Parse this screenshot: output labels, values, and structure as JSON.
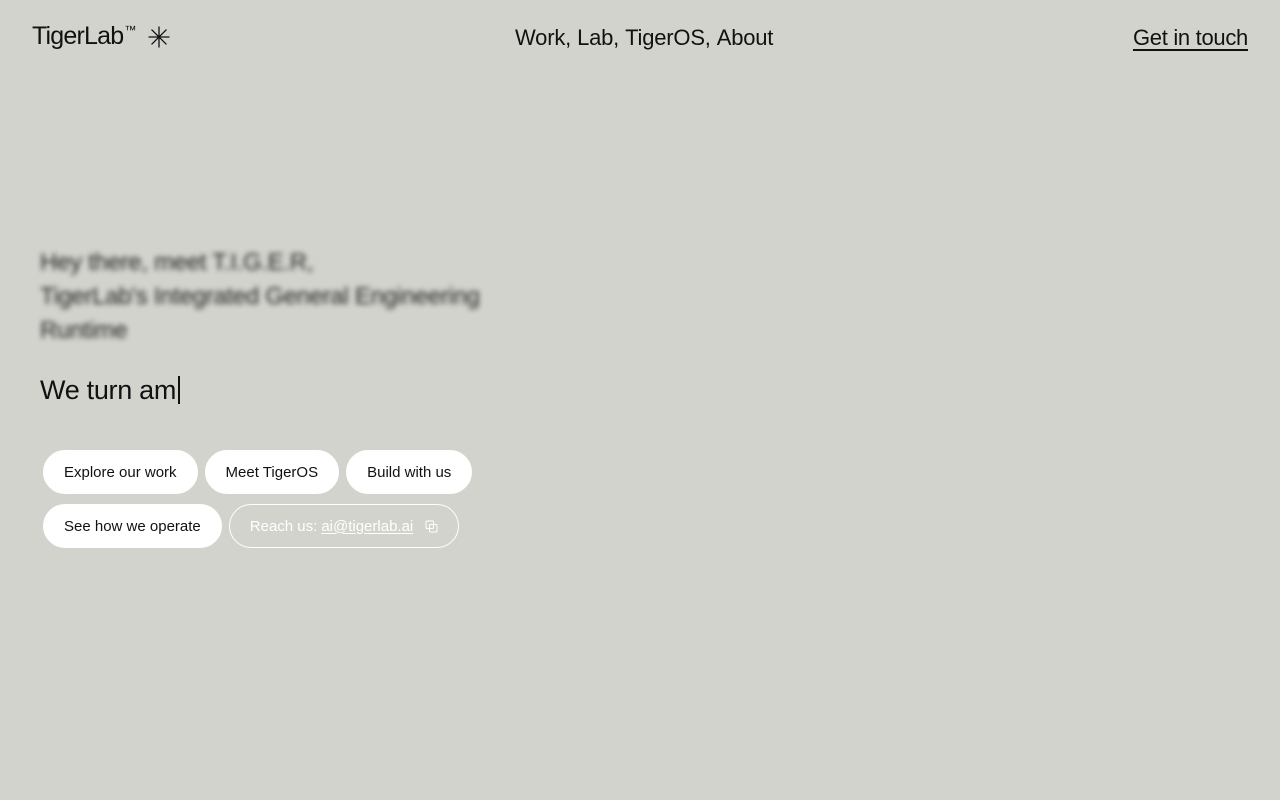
{
  "header": {
    "logo_text": "TigerLab",
    "logo_mark": "™",
    "logo_icon": "asterisk-icon",
    "nav": [
      {
        "label": "Work",
        "sep": ","
      },
      {
        "label": "Lab",
        "sep": ","
      },
      {
        "label": "TigerOS",
        "sep": ","
      },
      {
        "label": "About",
        "sep": ""
      }
    ],
    "cta_label": "Get in touch"
  },
  "hero": {
    "intro_line1": "Hey there, meet T.I.G.E.R,",
    "intro_line2": "TigerLab's Integrated General Engineering",
    "intro_line3": "Runtime",
    "typing_text": "We turn am"
  },
  "actions": {
    "explore": "Explore our work",
    "meet": "Meet TigerOS",
    "build": "Build with us",
    "operate": "See how we operate",
    "reach_label": "Reach us:",
    "reach_email": "ai@tigerlab.ai",
    "copy_icon": "copy-icon"
  },
  "colors": {
    "background": "#d3d3ce",
    "text": "#111111",
    "pill": "#ffffff"
  }
}
